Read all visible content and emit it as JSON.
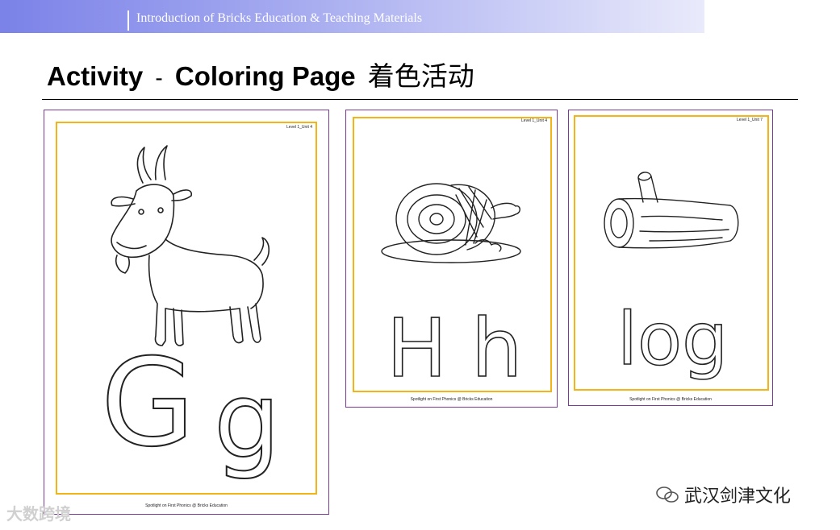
{
  "header": {
    "text": "Introduction of Bricks Education & Teaching Materials"
  },
  "title": {
    "english_1": "Activity",
    "dash": "-",
    "english_2": "Coloring Page",
    "chinese": "着色活动"
  },
  "cards": [
    {
      "level": "Level 1_Unit 4",
      "picture": "goat",
      "letters": "G g",
      "footer": "Spotlight on First Phonics @ Bricks Education"
    },
    {
      "level": "Level 1_Unit 4",
      "picture": "ham",
      "letters": "H h",
      "footer": "Spotlight on First Phonics @ Bricks Education"
    },
    {
      "level": "Level 1_Unit 7",
      "picture": "log",
      "letters": "log",
      "footer": "Spotlight on First Phonics @ Bricks Education"
    }
  ],
  "watermarks": {
    "left": "大数跨境",
    "right": "武汉剑津文化"
  },
  "colors": {
    "header_start": "#7b82e8",
    "frame": "#f2b417",
    "card_border": "#7a3c97"
  }
}
